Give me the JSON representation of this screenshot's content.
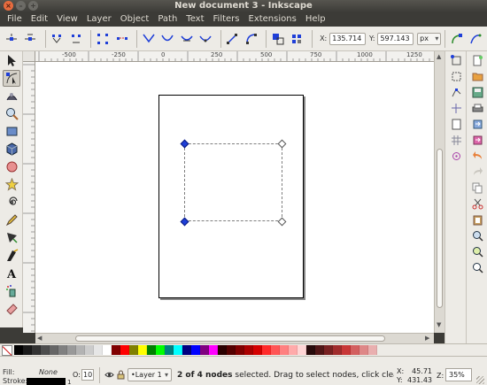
{
  "window": {
    "title": "New document 3 - Inkscape"
  },
  "menu": [
    "File",
    "Edit",
    "View",
    "Layer",
    "Object",
    "Path",
    "Text",
    "Filters",
    "Extensions",
    "Help"
  ],
  "controls": {
    "x_label": "X:",
    "x_value": "135.714",
    "y_label": "Y:",
    "y_value": "597.143",
    "unit": "px"
  },
  "ruler": {
    "top_labels": [
      "-500",
      "-250",
      "0",
      "250",
      "500",
      "750",
      "1000",
      "1250"
    ]
  },
  "tools": [
    "selector-icon",
    "node-tool-icon",
    "tweak-tool-icon",
    "zoom-tool-icon",
    "rectangle-tool-icon",
    "3d-box-tool-icon",
    "ellipse-tool-icon",
    "star-tool-icon",
    "spiral-tool-icon",
    "pencil-tool-icon",
    "pen-tool-icon",
    "calligraphy-tool-icon",
    "text-tool-icon",
    "spray-tool-icon",
    "eraser-tool-icon"
  ],
  "palette": [
    "#000000",
    "#1a1a1a",
    "#333333",
    "#4d4d4d",
    "#666666",
    "#808080",
    "#999999",
    "#b3b3b3",
    "#cccccc",
    "#e6e6e6",
    "#ffffff",
    "#800000",
    "#ff0000",
    "#808000",
    "#ffff00",
    "#008000",
    "#00ff00",
    "#008080",
    "#00ffff",
    "#000080",
    "#0000ff",
    "#800080",
    "#ff00ff",
    "#2b0000",
    "#550000",
    "#800000",
    "#aa0000",
    "#d40000",
    "#ff2a2a",
    "#ff5555",
    "#ff8080",
    "#ffaaaa",
    "#ffd5d5",
    "#280b0b",
    "#501616",
    "#782121",
    "#a02c2c",
    "#c83737",
    "#d35f5f",
    "#de8787",
    "#e9afaf"
  ],
  "status": {
    "fill_label": "Fill:",
    "stroke_label": "Stroke:",
    "fill_value": "None",
    "stroke_width": "1",
    "opacity_label": "O:",
    "opacity_value": "10",
    "layer": "•Layer 1",
    "message_bold": "2 of 4 nodes",
    "message_rest": " selected. Drag to select nodes, click clear th...",
    "x_label": "X:",
    "y_label": "Y:",
    "x_value": "45.71",
    "y_value": "431.43",
    "zoom_label": "Z:",
    "zoom_value": "35%"
  }
}
